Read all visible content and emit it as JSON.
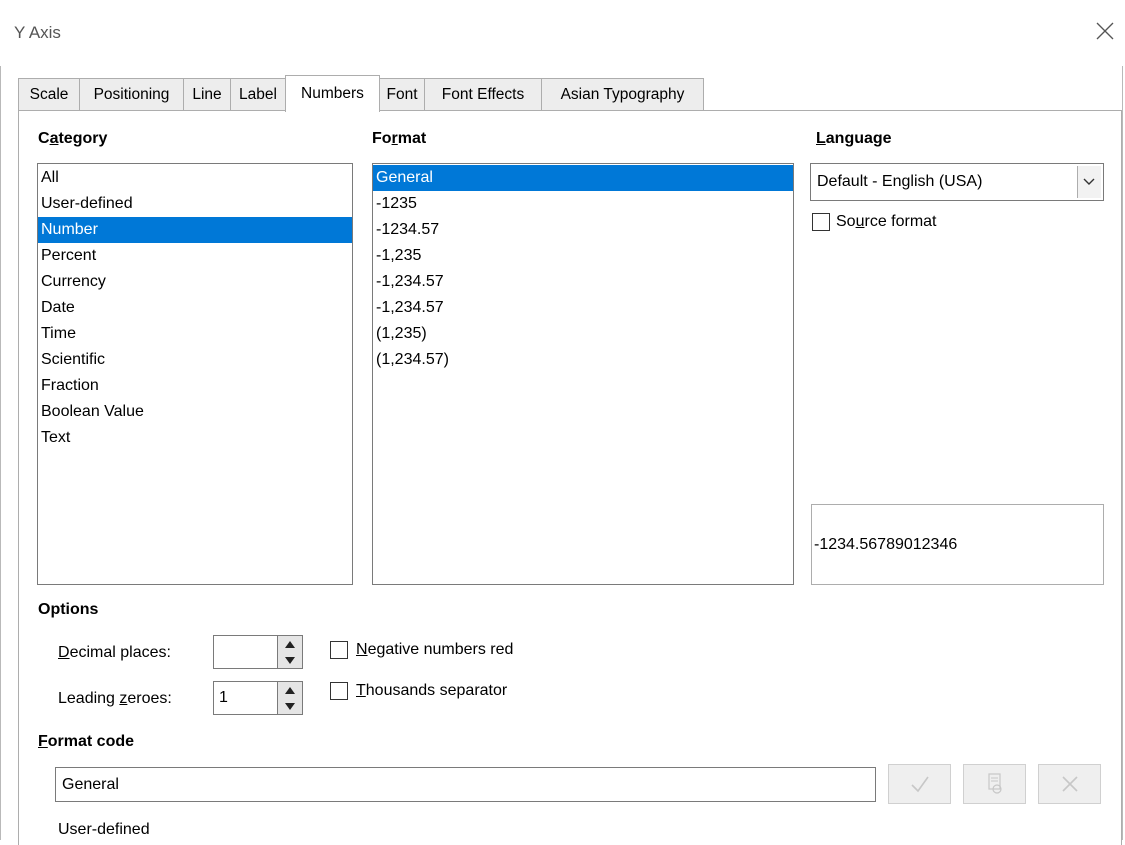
{
  "window": {
    "title": "Y Axis"
  },
  "tabs": [
    {
      "label": "Scale"
    },
    {
      "label": "Positioning"
    },
    {
      "label": "Line"
    },
    {
      "label": "Label"
    },
    {
      "label": "Numbers"
    },
    {
      "label": "Font"
    },
    {
      "label": "Font Effects"
    },
    {
      "label": "Asian Typography"
    }
  ],
  "active_tab": "Numbers",
  "category": {
    "label_pre": "C",
    "label_ul": "a",
    "label_post": "tegory",
    "items": [
      "All",
      "User-defined",
      "Number",
      "Percent",
      "Currency",
      "Date",
      "Time",
      "Scientific",
      "Fraction",
      "Boolean Value",
      "Text"
    ],
    "selected": "Number"
  },
  "format": {
    "label_pre": "Fo",
    "label_ul": "r",
    "label_post": "mat",
    "items": [
      "General",
      "-1235",
      "-1234.57",
      "-1,235",
      "-1,234.57",
      "-1,234.57",
      "(1,235)",
      "(1,234.57)"
    ],
    "selected": "General"
  },
  "language": {
    "label_pre": "",
    "label_ul": "L",
    "label_post": "anguage",
    "value": "Default - English (USA)"
  },
  "source_format": {
    "pre": "So",
    "ul": "u",
    "post": "rce format",
    "checked": false
  },
  "preview": {
    "value": "-1234.56789012346"
  },
  "options": {
    "label": "Options",
    "decimal_places": {
      "ul": "D",
      "post": "ecimal places:",
      "value": ""
    },
    "leading_zeroes": {
      "pre": "Leading ",
      "ul": "z",
      "post": "eroes:",
      "value": "1"
    },
    "negative_red": {
      "ul": "N",
      "post": "egative numbers red",
      "checked": false
    },
    "thousands": {
      "ul": "T",
      "post": "housands separator",
      "checked": false
    }
  },
  "format_code": {
    "ul": "F",
    "post": "ormat code",
    "value": "General",
    "status": "User-defined"
  },
  "icons": {
    "add": "check-icon",
    "edit_comment": "comment-icon",
    "remove": "delete-icon",
    "close": "close-icon"
  },
  "colors": {
    "selection": "#0078d7",
    "border": "#7a7a7a"
  }
}
